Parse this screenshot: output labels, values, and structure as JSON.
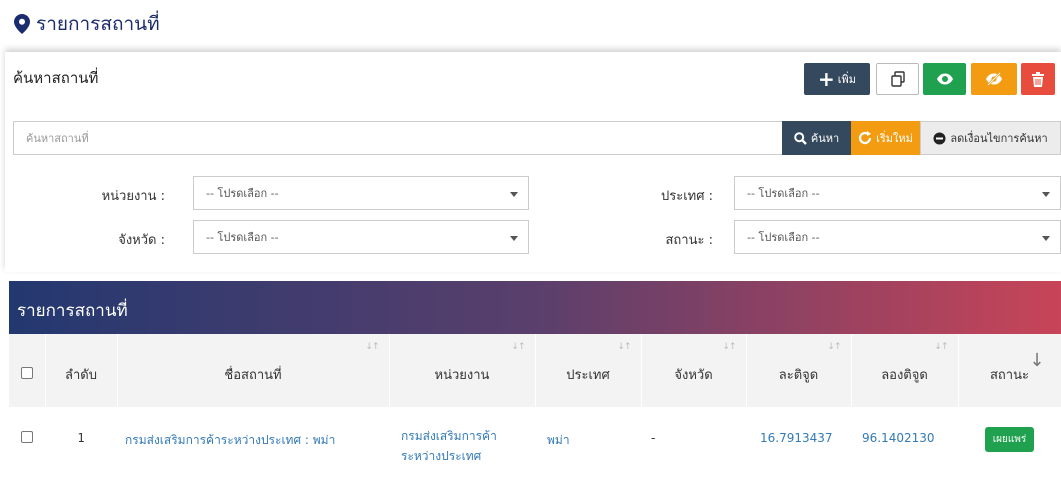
{
  "header": {
    "title": "รายการสถานที่"
  },
  "search_panel": {
    "title": "ค้นหาสถานที่",
    "toolbar": {
      "add_label": "เพิ่ม"
    },
    "search": {
      "placeholder": "ค้นหาสถานที่",
      "search_label": "ค้นหา",
      "reset_label": "เริ่มใหม่",
      "less_label": "ลดเงื่อนไขการค้นหา"
    },
    "filters": {
      "agency": {
        "label": "หน่วยงาน :",
        "value": "-- โปรดเลือก --"
      },
      "country": {
        "label": "ประเทศ :",
        "value": "-- โปรดเลือก --"
      },
      "province": {
        "label": "จังหวัด :",
        "value": "-- โปรดเลือก --"
      },
      "status": {
        "label": "สถานะ :",
        "value": "-- โปรดเลือก --"
      }
    }
  },
  "list": {
    "title": "รายการสถานที่",
    "columns": {
      "order": "ลำดับ",
      "name": "ชื่อสถานที่",
      "agency": "หน่วยงาน",
      "country": "ประเทศ",
      "province": "จังหวัด",
      "latitude": "ละติจูด",
      "longitude": "ลองติจูด",
      "status": "สถานะ"
    },
    "rows": [
      {
        "order": "1",
        "name": "กรมส่งเสริมการค้าระหว่างประเทศ : พม่า",
        "agency_line1": "กรมส่งเสริมการค้า",
        "agency_line2": "ระหว่างประเทศ",
        "country": "พม่า",
        "province": "-",
        "latitude": "16.7913437",
        "longitude": "96.1402130",
        "status": "เผยแพร่"
      }
    ]
  },
  "colors": {
    "title": "#1a2c6e",
    "primary_dark": "#34495e",
    "green": "#1fa14f",
    "orange": "#f39c12",
    "red": "#e74c3c",
    "link": "#337ab7",
    "gradient_start": "#233870",
    "gradient_end": "#c84458"
  },
  "icons": {
    "title": "map-marker-icon",
    "add": "plus-icon",
    "copy": "copy-icon",
    "show": "eye-icon",
    "hide": "eye-slash-icon",
    "delete": "trash-icon",
    "search": "search-icon",
    "reset": "refresh-icon",
    "less": "minus-circle-icon"
  }
}
